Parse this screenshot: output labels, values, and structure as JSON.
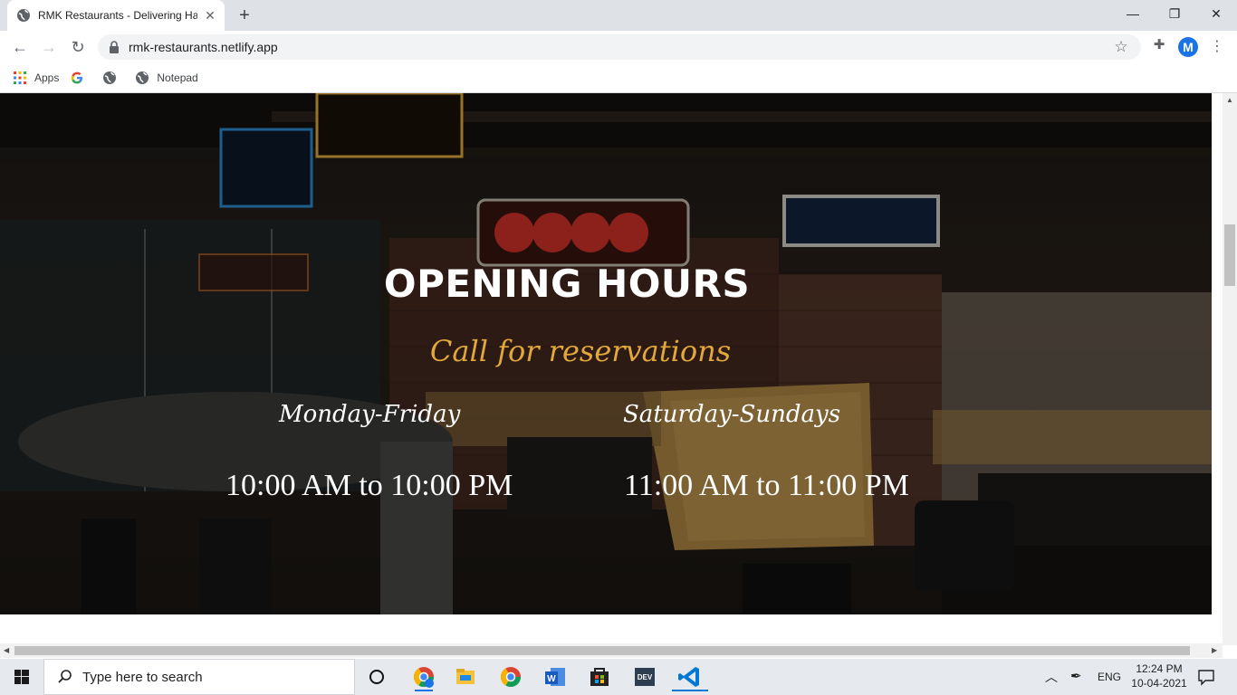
{
  "browser": {
    "tab_title": "RMK Restaurants - Delivering Ha",
    "url": "rmk-restaurants.netlify.app",
    "profile_initial": "M",
    "bookmarks": [
      {
        "label": "Apps",
        "icon": "apps-grid-icon"
      },
      {
        "label": "",
        "icon": "google-icon"
      },
      {
        "label": "",
        "icon": "globe-icon"
      },
      {
        "label": "Notepad",
        "icon": "globe-icon"
      }
    ]
  },
  "page": {
    "heading": "OPENING HOURS",
    "subheading": "Call for reservations",
    "schedule": [
      {
        "days": "Monday-Friday",
        "hours": "10:00 AM to 10:00 PM"
      },
      {
        "days": "Saturday-Sundays",
        "hours": "11:00 AM to 11:00 PM"
      }
    ],
    "accent_color": "#e2a83a"
  },
  "taskbar": {
    "search_placeholder": "Type here to search",
    "language": "ENG",
    "time": "12:24 PM",
    "date": "10-04-2021"
  }
}
